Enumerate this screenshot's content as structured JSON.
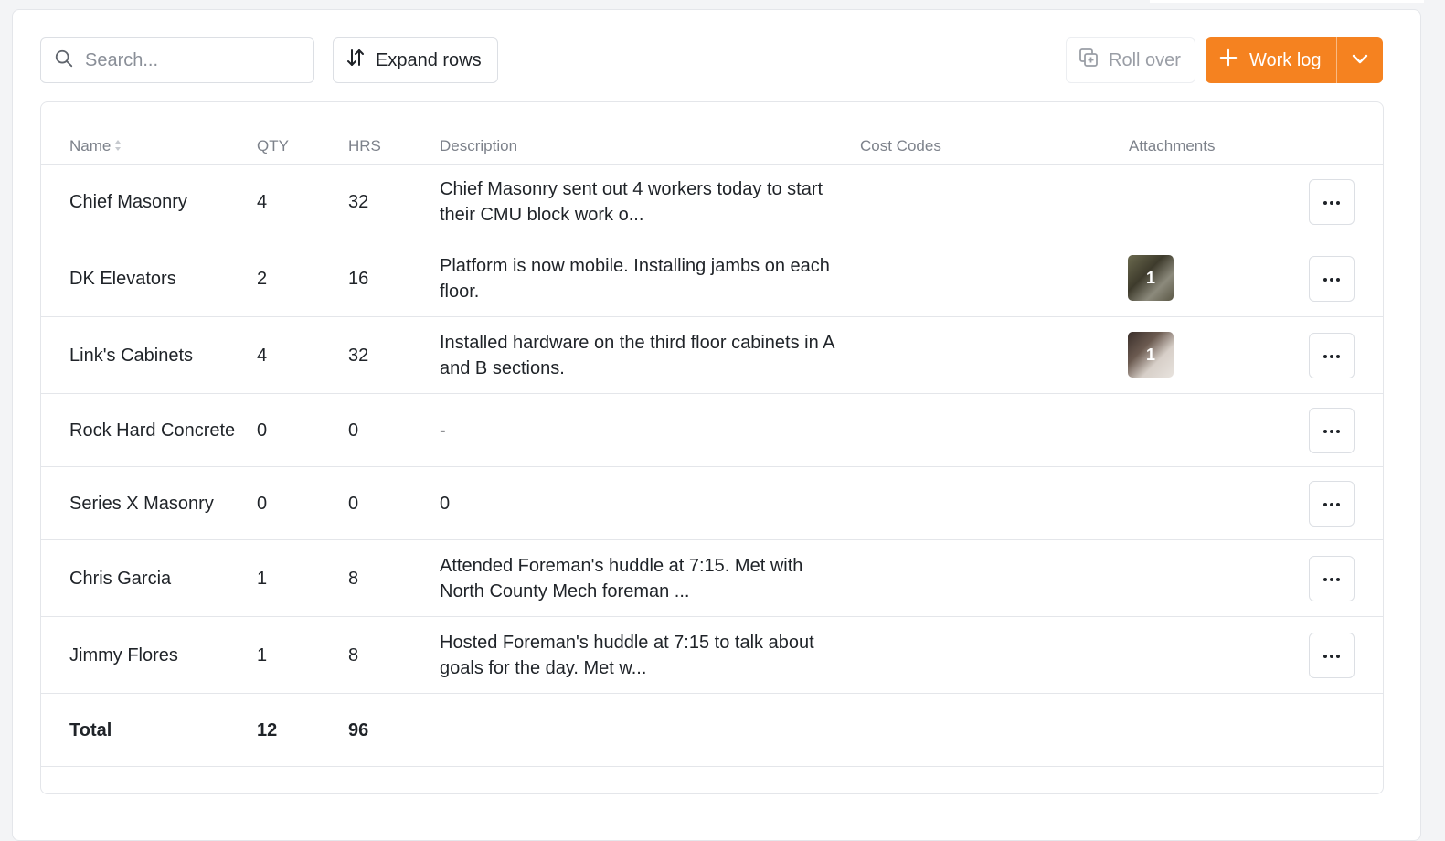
{
  "toolbar": {
    "search_placeholder": "Search...",
    "expand_label": "Expand rows",
    "rollover_label": "Roll over",
    "worklog_label": "Work log"
  },
  "columns": {
    "name": "Name",
    "qty": "QTY",
    "hrs": "HRS",
    "description": "Description",
    "cost_codes": "Cost Codes",
    "attachments": "Attachments"
  },
  "rows": [
    {
      "name": "Chief Masonry",
      "qty": "4",
      "hrs": "32",
      "desc1": "Chief Masonry sent out 4 workers today to start",
      "desc2": "their CMU block work o...",
      "attachments": null
    },
    {
      "name": "DK Elevators",
      "qty": "2",
      "hrs": "16",
      "desc1": "Platform is now mobile. Installing jambs on each",
      "desc2": "floor.",
      "attachments": "1"
    },
    {
      "name": "Link's Cabinets",
      "qty": "4",
      "hrs": "32",
      "desc1": "Installed hardware on the third floor cabinets in A",
      "desc2": "and B sections.",
      "attachments": "1"
    },
    {
      "name": "Rock Hard Concrete",
      "qty": "0",
      "hrs": "0",
      "desc1": "-",
      "desc2": "",
      "attachments": null
    },
    {
      "name": "Series X Masonry",
      "qty": "0",
      "hrs": "0",
      "desc1": "0",
      "desc2": "",
      "attachments": null
    },
    {
      "name": "Chris Garcia",
      "qty": "1",
      "hrs": "8",
      "desc1": "Attended Foreman's huddle at 7:15. Met with",
      "desc2": "North County Mech foreman ...",
      "attachments": null
    },
    {
      "name": "Jimmy Flores",
      "qty": "1",
      "hrs": "8",
      "desc1": "Hosted Foreman's huddle at 7:15 to talk about",
      "desc2": "goals for the day. Met w...",
      "attachments": null
    }
  ],
  "total": {
    "label": "Total",
    "qty": "12",
    "hrs": "96"
  },
  "colors": {
    "accent": "#f58220",
    "border": "#e4e6ea",
    "muted_text": "#7d828b"
  },
  "icons": {
    "search": "search-icon",
    "expand": "expand-rows-icon",
    "rollover": "rollover-icon",
    "add": "plus-icon",
    "caret": "chevron-down-icon",
    "more": "more-options-icon"
  }
}
